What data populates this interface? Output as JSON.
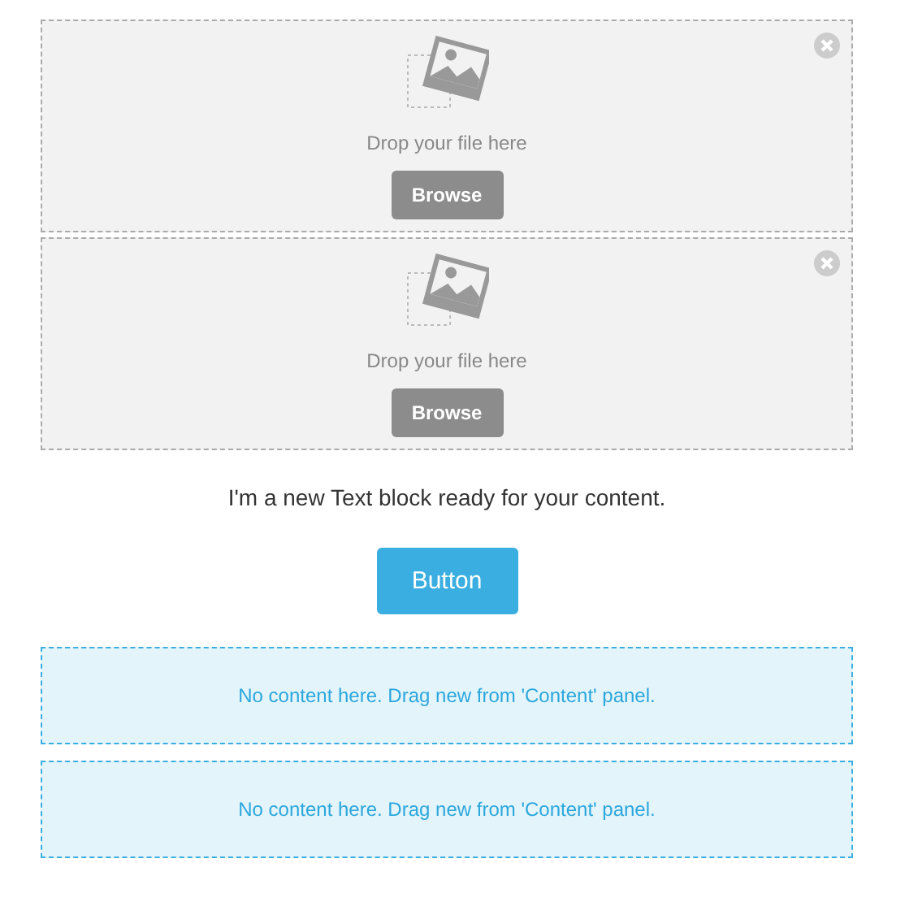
{
  "blocks": [
    {
      "kind": "image",
      "hint": "Drop your file here",
      "button": "Browse"
    },
    {
      "kind": "image",
      "hint": "Drop your file here",
      "button": "Browse"
    },
    {
      "kind": "text",
      "text": "I'm a new Text block ready for your content."
    },
    {
      "kind": "button",
      "label": "Button"
    },
    {
      "kind": "empty",
      "text": "No content here. Drag new from 'Content' panel."
    },
    {
      "kind": "empty",
      "text": "No content here. Drag new from 'Content' panel."
    }
  ]
}
